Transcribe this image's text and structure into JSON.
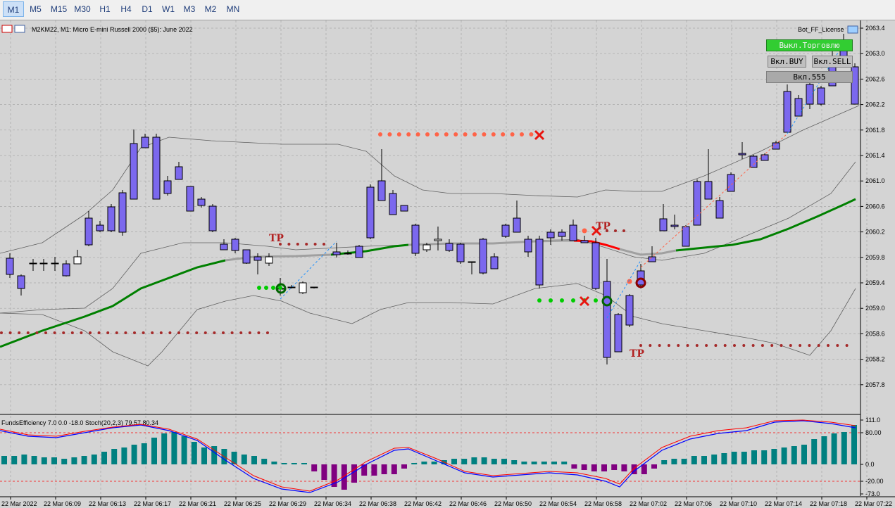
{
  "timeframes": [
    "M1",
    "M5",
    "M15",
    "M30",
    "H1",
    "H4",
    "D1",
    "W1",
    "M3",
    "M2",
    "MN"
  ],
  "active_timeframe": "M1",
  "chart": {
    "title": "M2KM22, M1:  Micro E-mini Russell 2000 ($5): June 2022",
    "ea_name": "Bot_FF_License",
    "price_ticks": [
      "2063.4",
      "2063.0",
      "2062.6",
      "2062.2",
      "2061.8",
      "2061.4",
      "2061.0",
      "2060.6",
      "2060.2",
      "2059.8",
      "2059.4",
      "2059.0",
      "2058.6",
      "2058.2",
      "2057.8"
    ],
    "tp_labels": [
      "TP",
      "TP",
      "TP"
    ]
  },
  "controls": {
    "trading_toggle": "Выкл.Торговлю",
    "buy_toggle": "Вкл.BUY",
    "sell_toggle": "Вкл.SELL",
    "x555_toggle": "Вкл.555"
  },
  "indicator": {
    "label": "FundsEfficiency 7.0 0.0 -18.0 Stoch(20,2,3) 79.57 80.34",
    "ticks": [
      "111.0",
      "80.00",
      "0.0",
      "-20.00",
      "-73.0"
    ]
  },
  "time_axis": [
    "22 Mar 2022",
    "22 Mar 06:09",
    "22 Mar 06:13",
    "22 Mar 06:17",
    "22 Mar 06:21",
    "22 Mar 06:25",
    "22 Mar 06:29",
    "22 Mar 06:34",
    "22 Mar 06:38",
    "22 Mar 06:42",
    "22 Mar 06:46",
    "22 Mar 06:50",
    "22 Mar 06:54",
    "22 Mar 06:58",
    "22 Mar 07:02",
    "22 Mar 07:06",
    "22 Mar 07:10",
    "22 Mar 07:14",
    "22 Mar 07:18",
    "22 Mar 07:22"
  ],
  "colors": {
    "bull_candle": "#ffffff",
    "bear_candle": "#7b68ee",
    "ma_green": "#008000",
    "ma_red": "#ff0000",
    "ma_gray": "#a0a0a0",
    "histogram": "#008080",
    "histogram_negative": "#800080",
    "stoch_main": "#0000ff",
    "stoch_signal": "#ff0000",
    "grid": "#a9a9a9",
    "tp_text": "#b22222",
    "dot_dark_red": "#a52a2a",
    "dot_salmon": "#ff6347",
    "dot_green": "#00cc00",
    "button_green": "#32cd32",
    "button_gray": "#c0c0c0"
  },
  "chart_data": {
    "type": "candlestick",
    "series": [
      {
        "name": "M2KM22",
        "values": []
      }
    ]
  }
}
